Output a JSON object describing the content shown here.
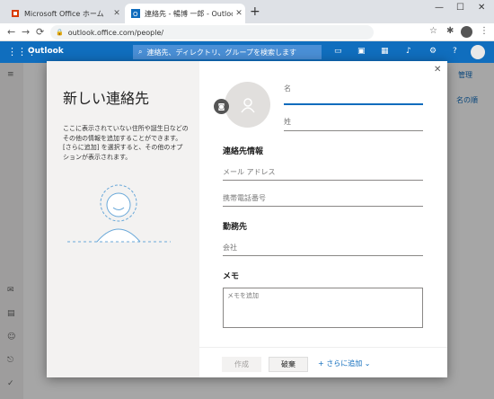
{
  "browser": {
    "tabs": [
      {
        "title": "Microsoft Office ホーム",
        "icon": "office-icon"
      },
      {
        "title": "連絡先 - 暢博 一郎 - Outlook",
        "icon": "outlook-icon"
      }
    ],
    "url": "outlook.office.com/people/"
  },
  "app": {
    "brand": "Outlook",
    "search_placeholder": "連絡先、ディレクトリ、グループを検索します",
    "bg_manage": "管理",
    "bg_sort": "名の順"
  },
  "dialog": {
    "title": "新しい連絡先",
    "description": "ここに表示されていない住所や誕生日などのその他の情報を追加することができます。[さらに追加] を選択すると、その他のオプションが表示されます。",
    "first_name_label": "名",
    "last_name_label": "姓",
    "contact_section": "連絡先情報",
    "email_placeholder": "メール アドレス",
    "phone_placeholder": "携帯電話番号",
    "work_section": "勤務先",
    "company_placeholder": "会社",
    "memo_section": "メモ",
    "memo_placeholder": "メモを追加",
    "create_button": "作成",
    "discard_button": "破棄",
    "add_more_button": "さらに追加"
  },
  "colors": {
    "accent": "#0f6cbd",
    "header": "#106ebe"
  }
}
